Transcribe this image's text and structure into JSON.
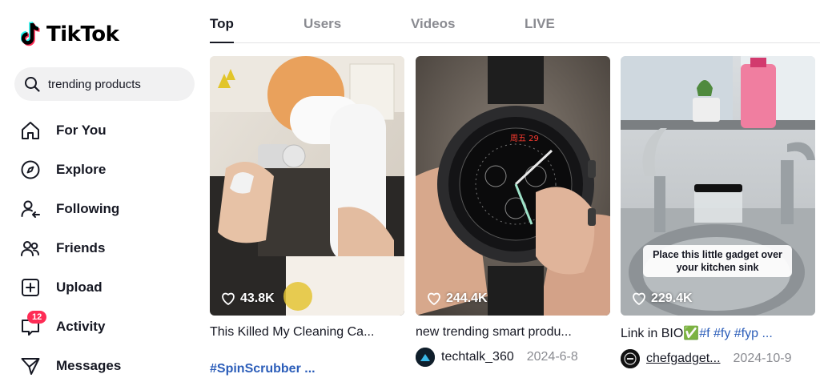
{
  "brand": {
    "name": "TikTok"
  },
  "search": {
    "query": "trending products"
  },
  "sidebar": {
    "items": [
      {
        "label": "For You",
        "icon": "home-icon"
      },
      {
        "label": "Explore",
        "icon": "compass-icon"
      },
      {
        "label": "Following",
        "icon": "following-icon"
      },
      {
        "label": "Friends",
        "icon": "friends-icon"
      },
      {
        "label": "Upload",
        "icon": "upload-icon"
      },
      {
        "label": "Activity",
        "icon": "activity-icon",
        "badge": "12"
      },
      {
        "label": "Messages",
        "icon": "messages-icon"
      }
    ]
  },
  "tabs": [
    {
      "label": "Top",
      "active": true
    },
    {
      "label": "Users",
      "active": false
    },
    {
      "label": "Videos",
      "active": false
    },
    {
      "label": "LIVE",
      "active": false
    }
  ],
  "videos": [
    {
      "likes": "43.8K",
      "caption": "This Killed My Cleaning Ca...",
      "hashtags": "#SpinScrubber ..."
    },
    {
      "likes": "244.4K",
      "caption": "new trending smart produ...",
      "author": "techtalk_360",
      "date": "2024-6-8"
    },
    {
      "likes": "229.4K",
      "caption_text": "Link in BIO",
      "caption_emoji": "✅",
      "caption_tags": "#f #fy #fyp ...",
      "author": "chefgadget...",
      "date": "2024-10-9",
      "overlay_text": "Place this little gadget over your kitchen sink"
    }
  ],
  "colors": {
    "accent": "#fe2c55",
    "hashtag": "#2b5db9",
    "muted": "#8a8b91"
  }
}
